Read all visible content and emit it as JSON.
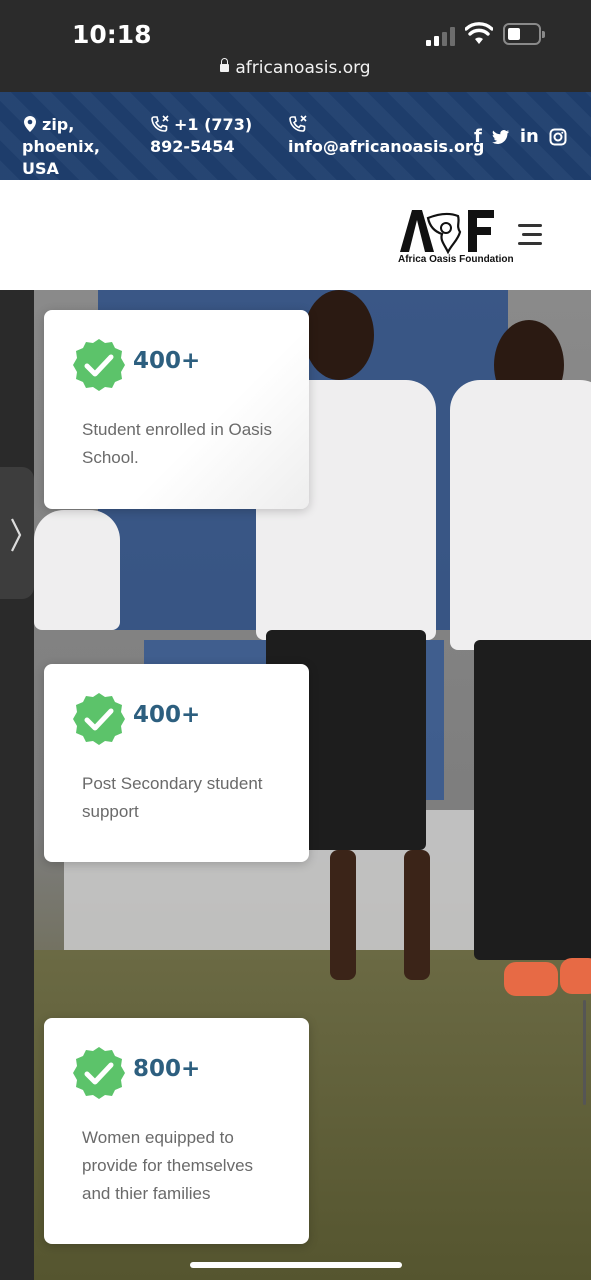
{
  "status_bar": {
    "time": "10:18",
    "url": "africanoasis.org"
  },
  "info_bar": {
    "address": "zip, phoenix, USA",
    "phone": "+1 (773) 892-5454",
    "email": "info@africanoasis.org",
    "social_icons": [
      "facebook-icon",
      "twitter-icon",
      "linkedin-icon",
      "instagram-icon"
    ]
  },
  "header": {
    "logo_letters": "AOF",
    "logo_subtitle": "Africa Oasis Foundation"
  },
  "stats": [
    {
      "count": "400+",
      "label": "Student enrolled in Oasis School."
    },
    {
      "count": "400+",
      "label": "Post Secondary student support"
    },
    {
      "count": "800+",
      "label": "Women equipped to provide for themselves and thier families"
    }
  ],
  "colors": {
    "info_bar_bg": "#1f3f6e",
    "badge_green": "#5cc36a",
    "count_text": "#2d5f7f",
    "desc_text": "#6a6a6a"
  }
}
